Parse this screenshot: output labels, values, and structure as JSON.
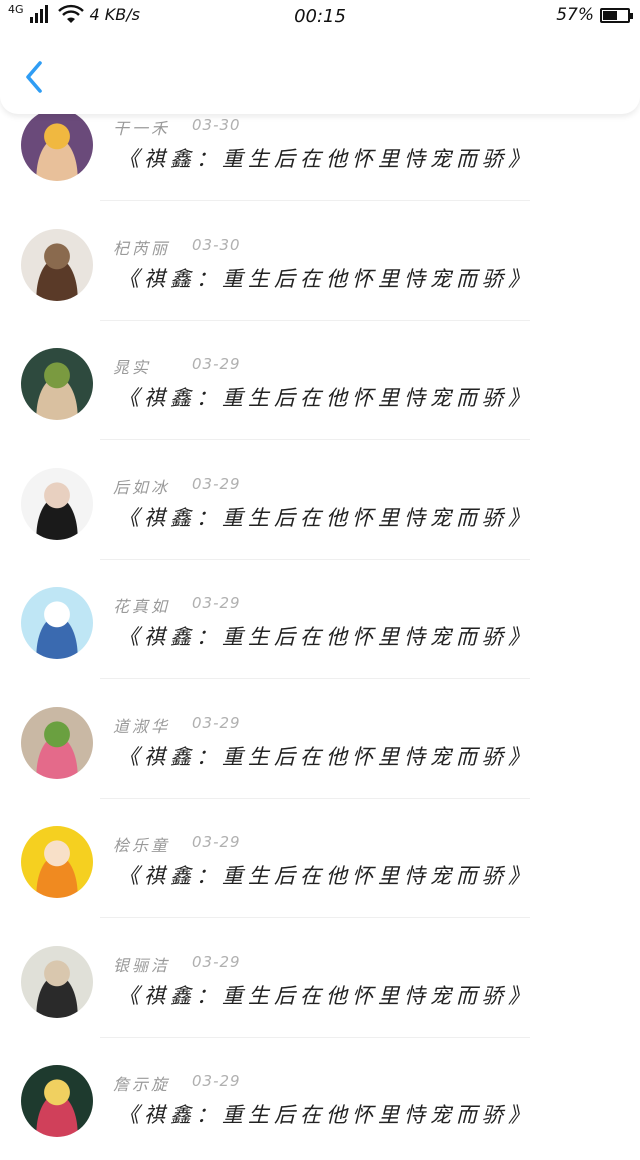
{
  "status_bar": {
    "network": "4G",
    "speed": "4 KB/s",
    "time": "00:15",
    "battery": "57%",
    "battery_level": 0.57
  },
  "header": {
    "back_icon": "chevron-left-icon",
    "accent_color": "#2f9df4"
  },
  "comments": [
    {
      "name": "干一禾",
      "date": "03-30",
      "text": "《祺鑫：重生后在他怀里恃宠而骄》",
      "avatar_colors": [
        "#6a4a7a",
        "#e8c09a",
        "#f0b840"
      ]
    },
    {
      "name": "杞芮丽",
      "date": "03-30",
      "text": "《祺鑫：重生后在他怀里恃宠而骄》",
      "avatar_colors": [
        "#e9e4de",
        "#5a3a28",
        "#8a6a4e"
      ]
    },
    {
      "name": "晁实",
      "date": "03-29",
      "text": "《祺鑫：重生后在他怀里恃宠而骄》",
      "avatar_colors": [
        "#2e4a3e",
        "#d9c0a0",
        "#7a9a40"
      ]
    },
    {
      "name": "后如冰",
      "date": "03-29",
      "text": "《祺鑫：重生后在他怀里恃宠而骄》",
      "avatar_colors": [
        "#f4f4f4",
        "#1a1a1a",
        "#e8d0c0"
      ]
    },
    {
      "name": "花真如",
      "date": "03-29",
      "text": "《祺鑫：重生后在他怀里恃宠而骄》",
      "avatar_colors": [
        "#bfe6f5",
        "#3a6ab0",
        "#ffffff"
      ]
    },
    {
      "name": "道淑华",
      "date": "03-29",
      "text": "《祺鑫：重生后在他怀里恃宠而骄》",
      "avatar_colors": [
        "#c9b8a4",
        "#e46a8a",
        "#6aa040"
      ]
    },
    {
      "name": "桧乐童",
      "date": "03-29",
      "text": "《祺鑫：重生后在他怀里恃宠而骄》",
      "avatar_colors": [
        "#f5d020",
        "#f08a20",
        "#f8e0c8"
      ]
    },
    {
      "name": "银骊洁",
      "date": "03-29",
      "text": "《祺鑫：重生后在他怀里恃宠而骄》",
      "avatar_colors": [
        "#e0e0d8",
        "#2a2a2a",
        "#d9c7ae"
      ]
    },
    {
      "name": "詹示旋",
      "date": "03-29",
      "text": "《祺鑫：重生后在他怀里恃宠而骄》",
      "avatar_colors": [
        "#1e3a2e",
        "#d0405a",
        "#f0d060"
      ]
    }
  ]
}
